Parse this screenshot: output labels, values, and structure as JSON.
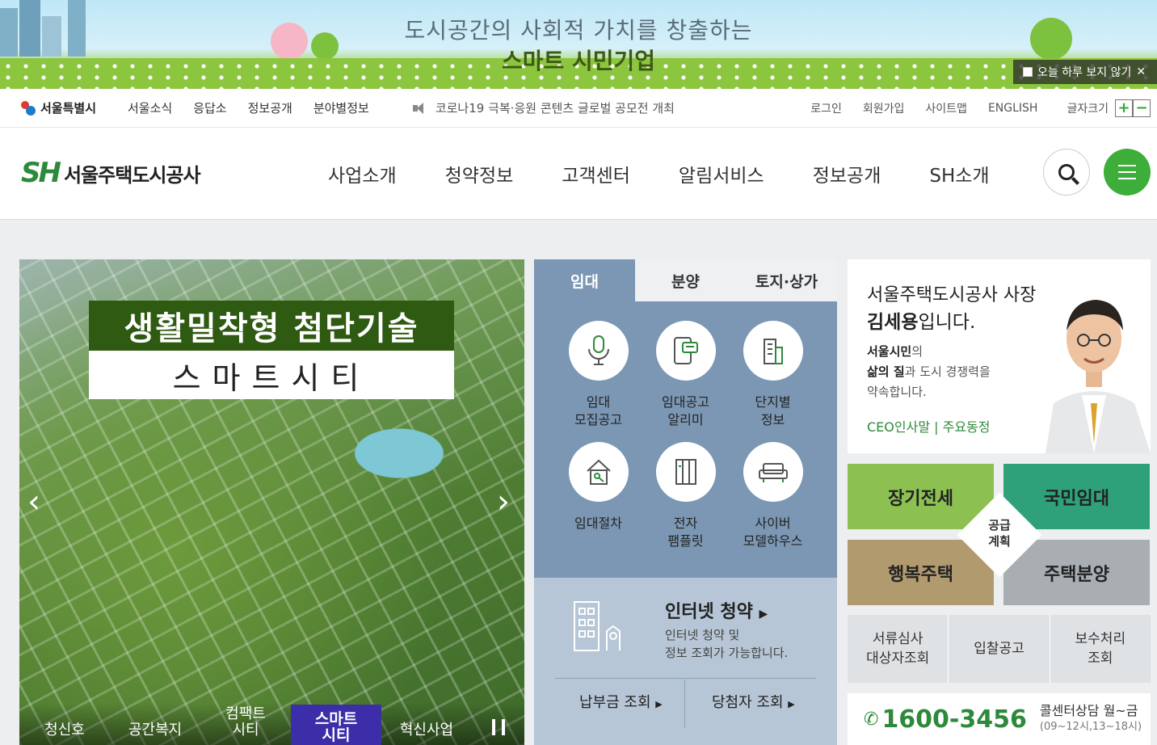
{
  "promo": {
    "line1": "도시공간의 사회적 가치를 창출하는",
    "line2": "스마트 시민기업",
    "close_label": "오늘 하루 보지 않기"
  },
  "utility": {
    "seoul_logo": "서울특별시",
    "nav": [
      "서울소식",
      "응답소",
      "정보공개",
      "분야별정보"
    ],
    "notice": "코로나19 극복·응원 콘텐츠 글로벌 공모전 개최",
    "links": [
      "로그인",
      "회원가입",
      "사이트맵",
      "ENGLISH"
    ],
    "fontsize_label": "글자크기",
    "plus": "+",
    "minus": "−"
  },
  "header": {
    "logo_text": "서울주택도시공사",
    "logo_mark": "SH",
    "nav": [
      "사업소개",
      "청약정보",
      "고객센터",
      "알림서비스",
      "정보공개",
      "SH소개"
    ]
  },
  "hero": {
    "title": "생활밀착형 첨단기술",
    "subtitle": "스마트시티",
    "tabs": [
      "청신호",
      "공간복지",
      "컴팩트\n시티",
      "스마트\n시티",
      "혁신사업"
    ],
    "active_tab": 3
  },
  "rental": {
    "tabs": [
      "임대",
      "분양",
      "토지·상가"
    ],
    "items": [
      {
        "label": "임대\n모집공고",
        "icon": "microphone-icon"
      },
      {
        "label": "임대공고\n알리미",
        "icon": "phone-message-icon"
      },
      {
        "label": "단지별\n정보",
        "icon": "building-icon"
      },
      {
        "label": "임대절차",
        "icon": "house-key-icon"
      },
      {
        "label": "전자\n팸플릿",
        "icon": "pamphlet-icon"
      },
      {
        "label": "사이버\n모델하우스",
        "icon": "sofa-icon"
      }
    ],
    "internet_title": "인터넷 청약",
    "internet_desc": "인터넷 청약 및\n정보 조회가 가능합니다.",
    "link1": "납부금 조회",
    "link2": "당첨자 조회"
  },
  "ceo": {
    "title1": "서울주택도시공사 사장",
    "name": "김세용",
    "name_suffix": "입니다.",
    "msg_b1": "서울시민",
    "msg_t1": "의",
    "msg_b2": "삶의 질",
    "msg_t2": "과 도시 경쟁력을",
    "msg_t3": "약속합니다.",
    "links": "CEO인사말 | 주요동정"
  },
  "supply": {
    "a": "장기전세",
    "b": "국민임대",
    "c": "행복주택",
    "d": "주택분양",
    "center": "공급\n계획"
  },
  "quick": [
    "서류심사\n대상자조회",
    "입찰공고",
    "보수처리\n조회"
  ],
  "call": {
    "number": "1600-3456",
    "hours": "콜센터상담 월~금",
    "hours_detail": "(09~12시,13~18시)"
  }
}
